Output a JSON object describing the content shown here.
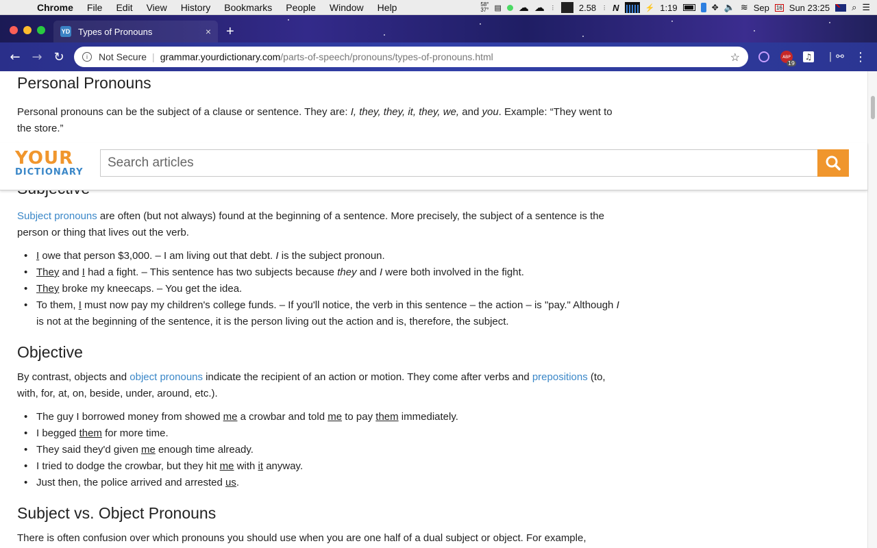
{
  "menubar": {
    "apple": "",
    "items": [
      "Chrome",
      "File",
      "Edit",
      "View",
      "History",
      "Bookmarks",
      "People",
      "Window",
      "Help"
    ],
    "status": {
      "temp_top": "58°",
      "temp_bottom": "37°",
      "load": "2.58",
      "battery_time": "1:19",
      "date": "Sep",
      "calendar_day": "16",
      "clock": "Sun 23:25"
    }
  },
  "browser": {
    "tab_title": "Types of Pronouns",
    "favicon_text": "YD",
    "close_glyph": "×",
    "new_tab_glyph": "+",
    "security_label": "Not Secure",
    "url_host": "grammar.yourdictionary.com",
    "url_path": "/parts-of-speech/pronouns/types-of-pronouns.html",
    "extension_badge": "19",
    "extension_label": "ABP"
  },
  "site": {
    "logo_line1": "YOUR",
    "logo_line2": "DICTIONARY",
    "search_placeholder": "Search articles"
  },
  "article": {
    "personal": {
      "heading": "Personal Pronouns",
      "p_start": "Personal pronouns can be the subject of a clause or sentence. They are: ",
      "p_list": "I, they, they, it, they, we,",
      "p_and": " and ",
      "p_you": "you",
      "p_end": ". Example: “They went to the store.”"
    },
    "subjective": {
      "heading": "Subjective",
      "link": "Subject pronouns",
      "p_rest": " are often (but not always) found at the beginning of a sentence. More precisely, the subject of a sentence is the person or thing that lives out the verb.",
      "items": [
        {
          "u": "I",
          "a": " owe that person $3,000. – I am living out that debt. ",
          "it": "I",
          "b": " is the subject pronoun."
        },
        {
          "u": "They",
          "a": " and ",
          "u2": "I",
          "b": " had a fight. – This sentence has two subjects because ",
          "it": "they",
          "c": " and ",
          "it2": "I",
          "d": " were both involved in the fight."
        },
        {
          "u": "They",
          "a": " broke my kneecaps. – You get the idea."
        },
        {
          "pre": "To them, ",
          "u": "I",
          "a": " must now pay my children's college funds. – If you'll notice, the verb in this sentence – the action – is \"pay.\" Although ",
          "it": "I",
          "b": " is not at the beginning of the sentence, it is the person living out the action and is, therefore, the subject."
        }
      ]
    },
    "objective": {
      "heading": "Objective",
      "p_start": "By contrast, objects and ",
      "link1": "object pronouns",
      "p_mid": " indicate the recipient of an action or motion. They come after verbs and ",
      "link2": "prepositions",
      "p_end": " (to, with, for, at, on, beside, under, around, etc.).",
      "items": [
        {
          "a": "The guy I borrowed money from showed ",
          "u1": "me",
          "b": " a crowbar and told ",
          "u2": "me",
          "c": " to pay ",
          "u3": "them",
          "d": " immediately."
        },
        {
          "a": "I begged ",
          "u1": "them",
          "b": " for more time."
        },
        {
          "a": "They said they'd given ",
          "u1": "me",
          "b": " enough time already."
        },
        {
          "a": "I tried to dodge the crowbar, but they hit ",
          "u1": "me",
          "b": " with ",
          "u2": "it",
          "c": " anyway."
        },
        {
          "a": "Just then, the police arrived and arrested ",
          "u1": "us",
          "b": "."
        }
      ]
    },
    "subject_vs_object": {
      "heading": "Subject vs. Object Pronouns",
      "p": "There is often confusion over which pronouns you should use when you are one half of a dual subject or object. For example,"
    }
  }
}
